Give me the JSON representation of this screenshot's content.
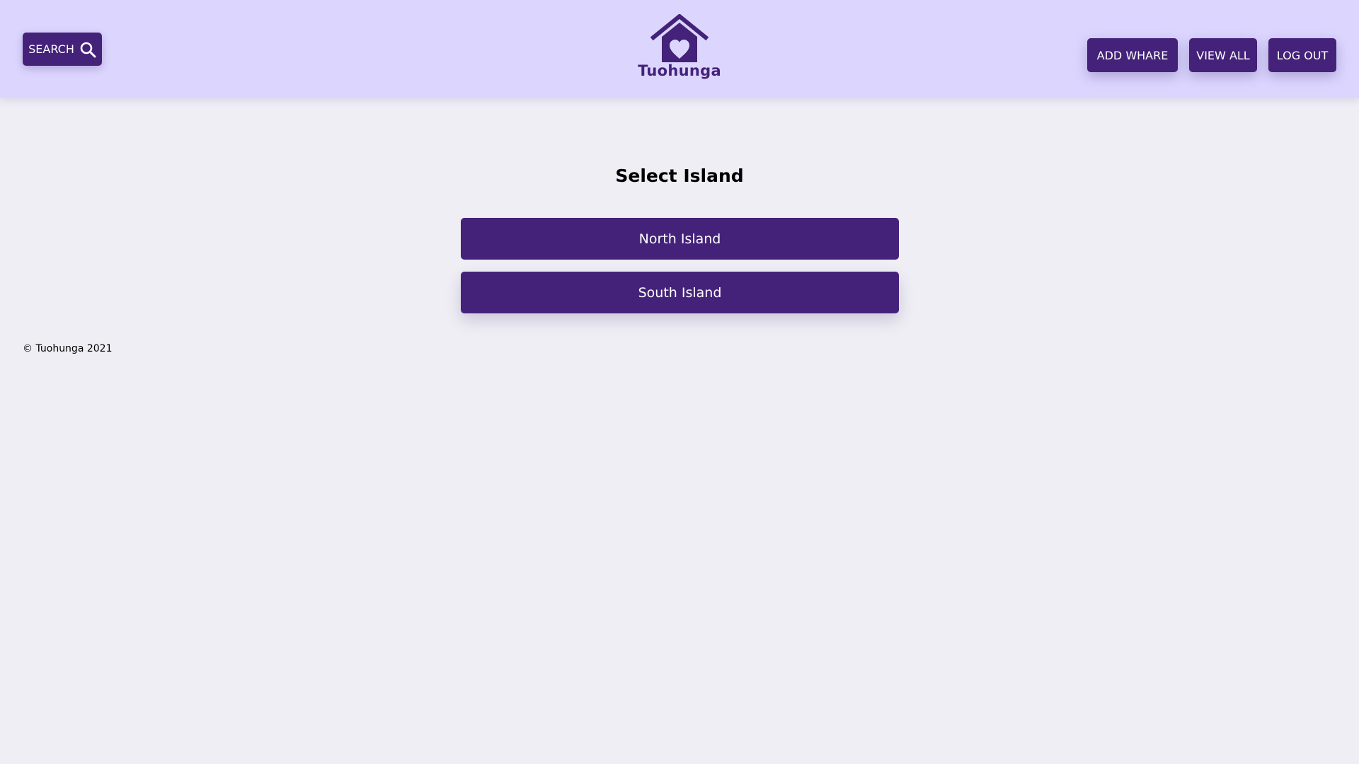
{
  "header": {
    "search_label": "SEARCH",
    "search_icon": "search-icon",
    "logo_icon": "house-heart-icon",
    "brand": "Tuohunga",
    "nav": {
      "add_whare": "ADD WHARE",
      "view_all": "VIEW ALL",
      "log_out": "LOG OUT"
    }
  },
  "main": {
    "title": "Select Island",
    "options": [
      "North Island",
      "South Island"
    ]
  },
  "footer": {
    "copyright": "© Tuohunga 2021"
  },
  "colors": {
    "header_bg": "#dcd6ff",
    "page_bg": "#efeef4",
    "accent": "#44227a",
    "button_text": "#ffffff"
  }
}
